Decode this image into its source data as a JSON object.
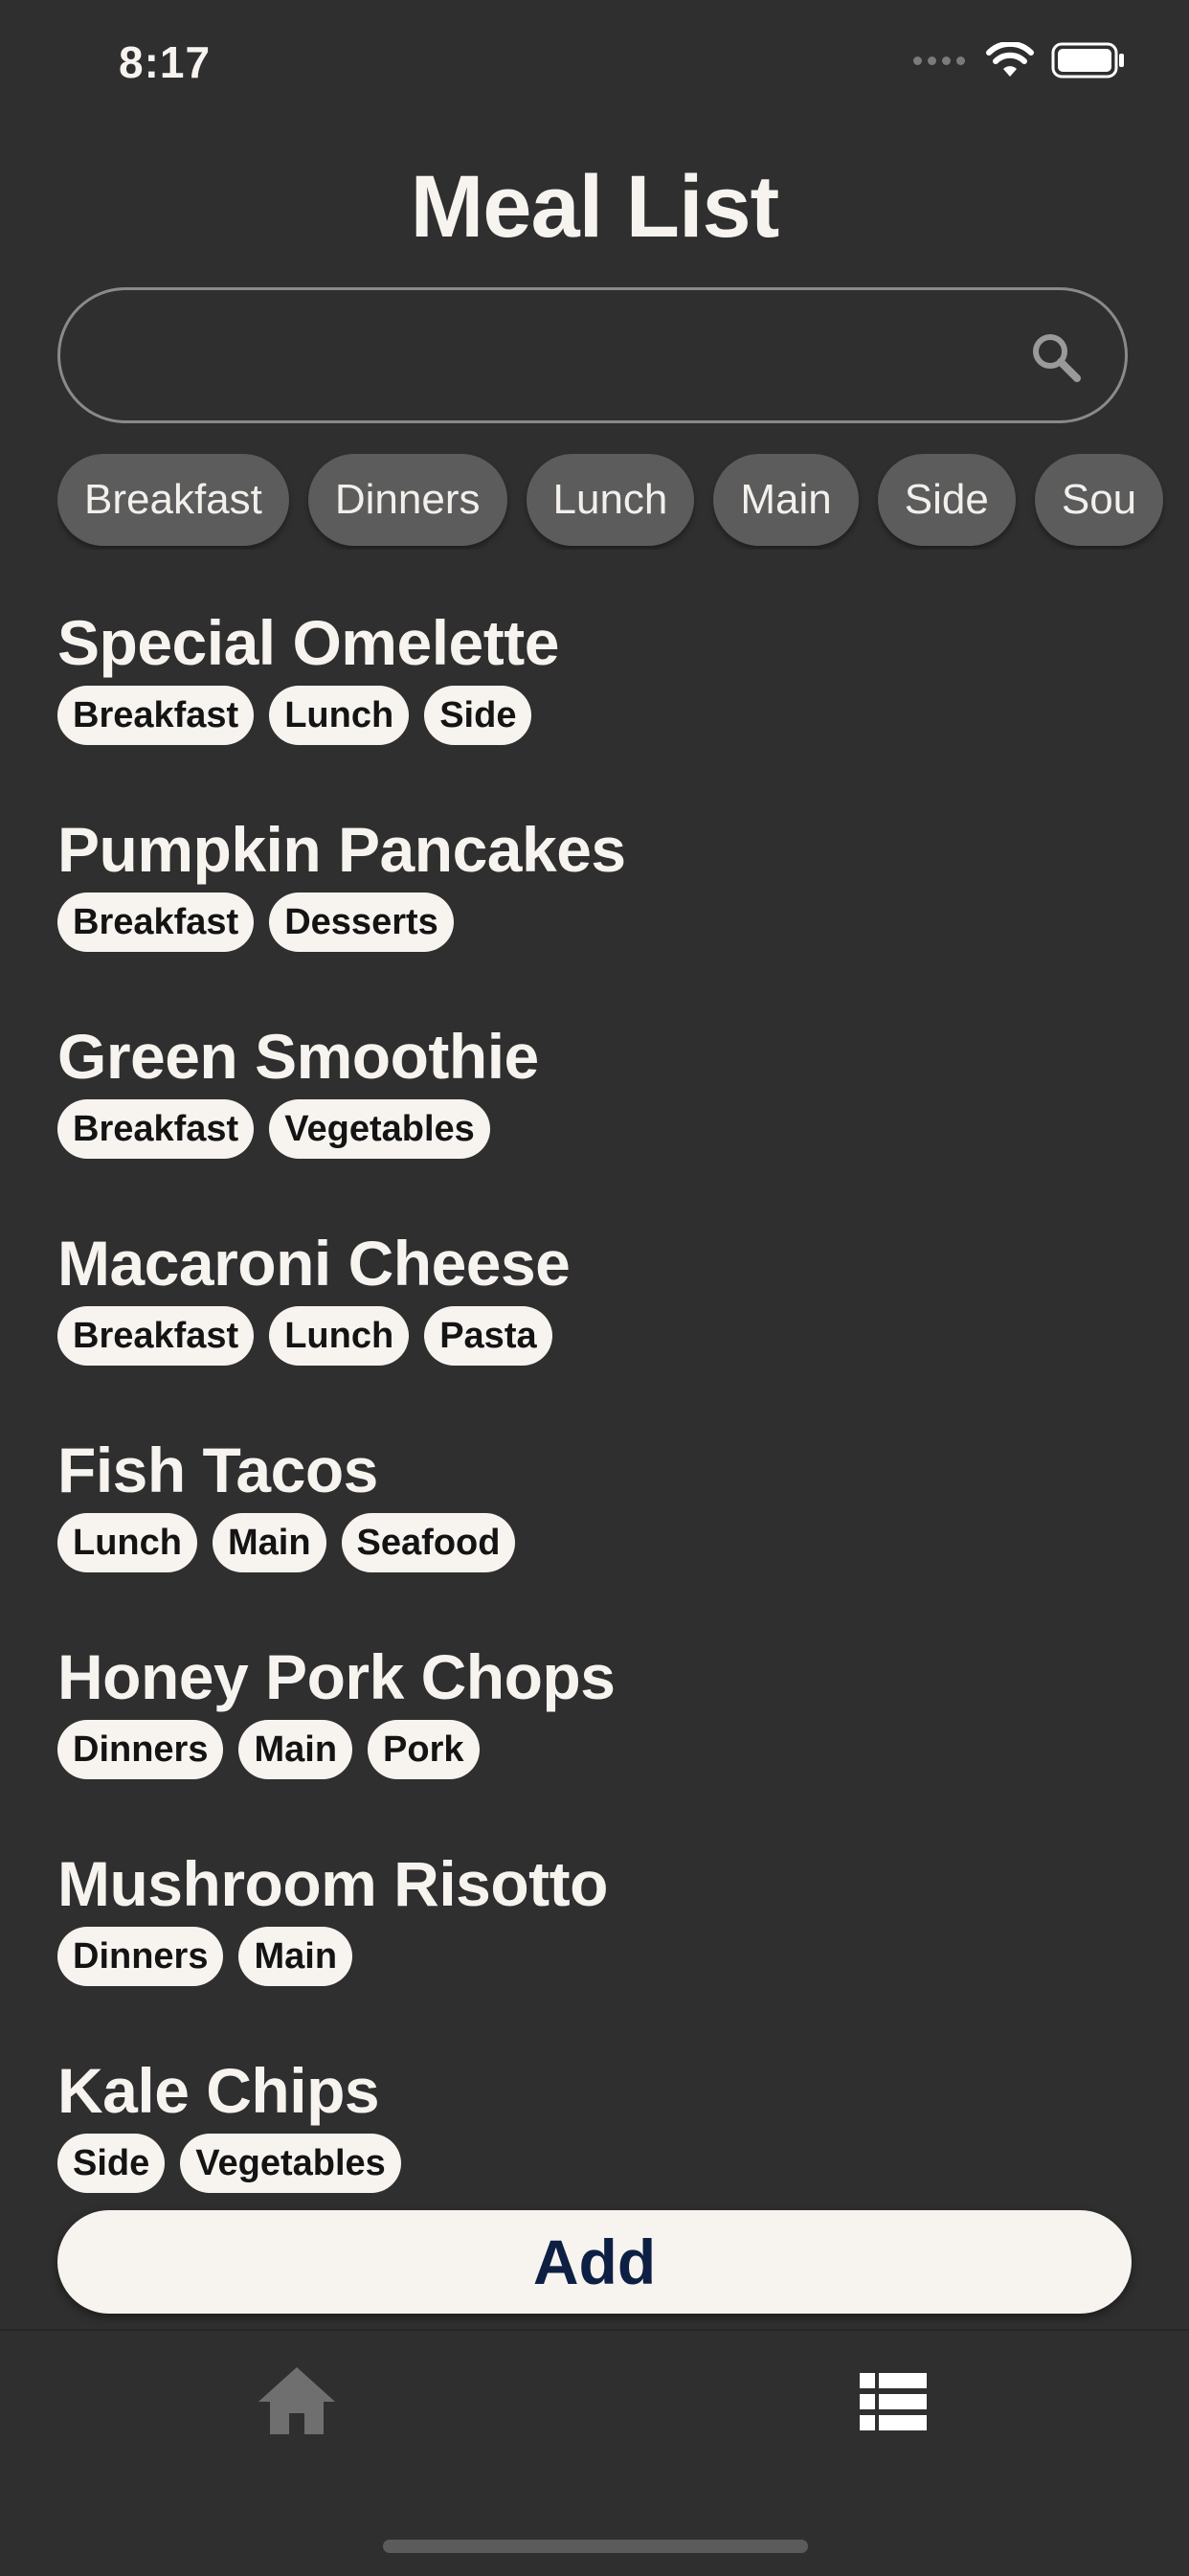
{
  "status_bar": {
    "time": "8:17"
  },
  "title": "Meal List",
  "search": {
    "value": "",
    "placeholder": ""
  },
  "filters": [
    "Breakfast",
    "Dinners",
    "Lunch",
    "Main",
    "Side",
    "Sou"
  ],
  "meals": [
    {
      "name": "Special Omelette",
      "tags": [
        "Breakfast",
        "Lunch",
        "Side"
      ]
    },
    {
      "name": "Pumpkin Pancakes",
      "tags": [
        "Breakfast",
        "Desserts"
      ]
    },
    {
      "name": "Green Smoothie",
      "tags": [
        "Breakfast",
        "Vegetables"
      ]
    },
    {
      "name": "Macaroni Cheese",
      "tags": [
        "Breakfast",
        "Lunch",
        "Pasta"
      ]
    },
    {
      "name": "Fish Tacos",
      "tags": [
        "Lunch",
        "Main",
        "Seafood"
      ]
    },
    {
      "name": "Honey Pork Chops",
      "tags": [
        "Dinners",
        "Main",
        "Pork"
      ]
    },
    {
      "name": "Mushroom Risotto",
      "tags": [
        "Dinners",
        "Main"
      ]
    },
    {
      "name": "Kale Chips",
      "tags": [
        "Side",
        "Vegetables"
      ]
    }
  ],
  "add_button": {
    "label": "Add"
  },
  "tab_bar": {
    "items": [
      {
        "icon": "home-icon"
      },
      {
        "icon": "list-icon"
      }
    ]
  },
  "colors": {
    "background": "#2f2f30",
    "chip": "#5c5c5d",
    "tag": "#f7f4f0",
    "add_text": "#0e1f44"
  }
}
